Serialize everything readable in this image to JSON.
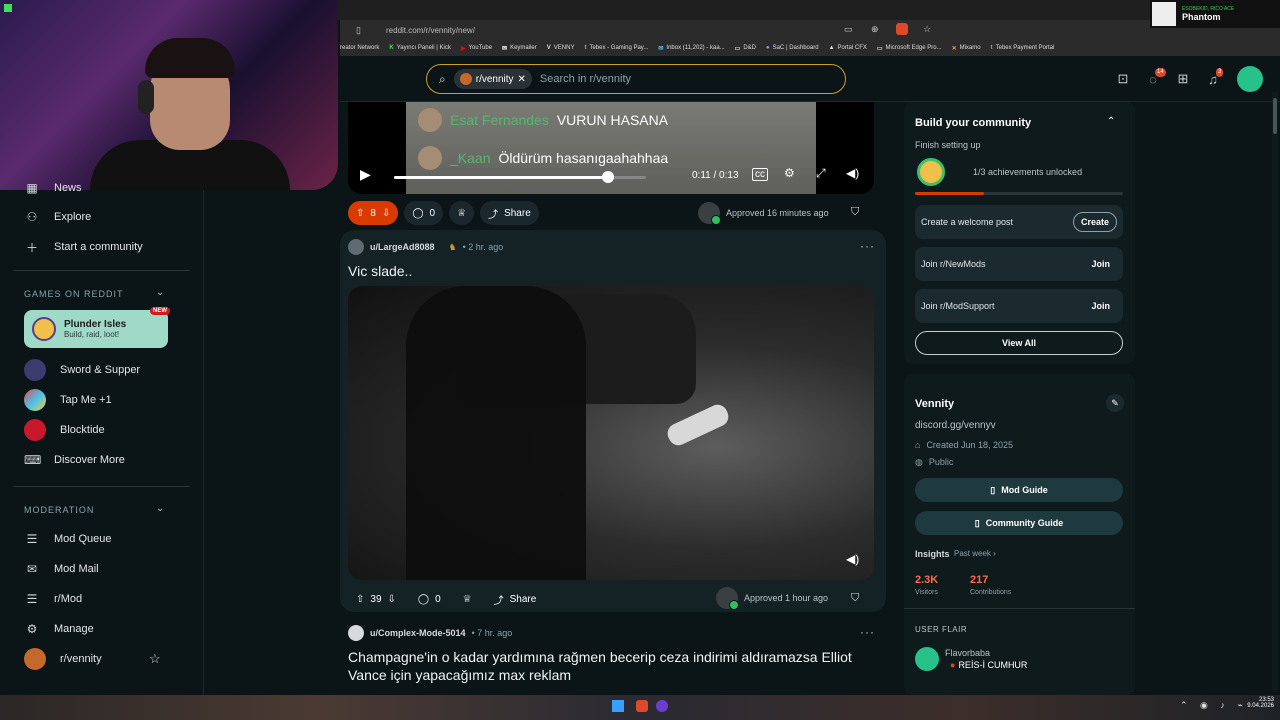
{
  "overlay": {
    "phantom_sub": "ESOBEKID, RICO ACE",
    "phantom_name": "Phantom"
  },
  "browser": {
    "url": "reddit.com/r/vennity/new/",
    "bookmarks": [
      "reator Network",
      "Yayıncı Paneli | Kick",
      "YouTube",
      "Keymailer",
      "VENNY",
      "Tebex - Gaming Pay...",
      "Inbox (11,202) - kaa...",
      "D&D",
      "SaC | Dashboard",
      "Portal CFX",
      "Microsoft Edge Pro...",
      "Mixamo",
      "Tebex Payment Portal"
    ]
  },
  "search": {
    "chip": "r/vennity",
    "placeholder": "Search in r/vennity"
  },
  "header": {
    "chat_badge": "14",
    "notif_badge": "3"
  },
  "sidebar": {
    "top_items": [
      "News",
      "Explore",
      "Start a community"
    ],
    "games_title": "GAMES ON REDDIT",
    "plunder": {
      "title": "Plunder Isles",
      "sub": "Build, raid, loot!",
      "tag": "NEW"
    },
    "games": [
      "Sword & Supper",
      "Tap Me +1",
      "Blocktide",
      "Discover More"
    ],
    "moderation_title": "MODERATION",
    "mod_items": [
      "Mod Queue",
      "Mod Mail",
      "r/Mod",
      "Manage",
      "r/vennity"
    ]
  },
  "post1": {
    "chat1_name": "Esat Fernandes",
    "chat1_msg": "VURUN HASANA",
    "chat2_name": "_Kaan",
    "chat2_msg": "Öldürüm hasanıgaahahhaa",
    "time": "0:11 / 0:13",
    "progress": 0.85,
    "votes": "8",
    "comments": "0",
    "share": "Share",
    "approved": "Approved 16 minutes ago"
  },
  "post2": {
    "user": "u/LargeAd8088",
    "ago": "• 2 hr. ago",
    "title": "Vic slade..",
    "votes": "39",
    "comments": "0",
    "share": "Share",
    "approved": "Approved 1 hour ago"
  },
  "post3": {
    "user": "u/Complex-Mode-5014",
    "ago": "• 7 hr. ago",
    "title_line1": "Champagne'in o kadar yardımına rağmen becerip ceza indirimi aldıramazsa Elliot",
    "title_line2": "Vance için yapacağımız max reklam"
  },
  "right": {
    "build_title": "Build your community",
    "build_sub": "Finish setting up",
    "achievements": "1/3 achievements unlocked",
    "tasks": [
      {
        "label": "Create a welcome post",
        "btn": "Create"
      },
      {
        "label": "Join r/NewMods",
        "btn": "Join"
      },
      {
        "label": "Join r/ModSupport",
        "btn": "Join"
      }
    ],
    "view_all": "View All",
    "community_name": "Vennity",
    "discord": "discord.gg/vennyv",
    "created": "Created Jun 18, 2025",
    "visibility": "Public",
    "mod_guide": "Mod Guide",
    "community_guide": "Community Guide",
    "insights": "Insights",
    "past_week": "Past week ›",
    "visitors_val": "2.3K",
    "visitors_lbl": "Visitors",
    "contrib_val": "217",
    "contrib_lbl": "Contributions",
    "user_flair_title": "USER FLAIR",
    "flair_name": "Flavorbaba",
    "flair_text": "REİS-İ CUMHUR"
  },
  "clock": {
    "time": "23:53",
    "date": "9.04.2026"
  },
  "colors": {
    "accent": "#d93a00",
    "brand_green": "#26c28a",
    "bg": "#0b1416"
  }
}
